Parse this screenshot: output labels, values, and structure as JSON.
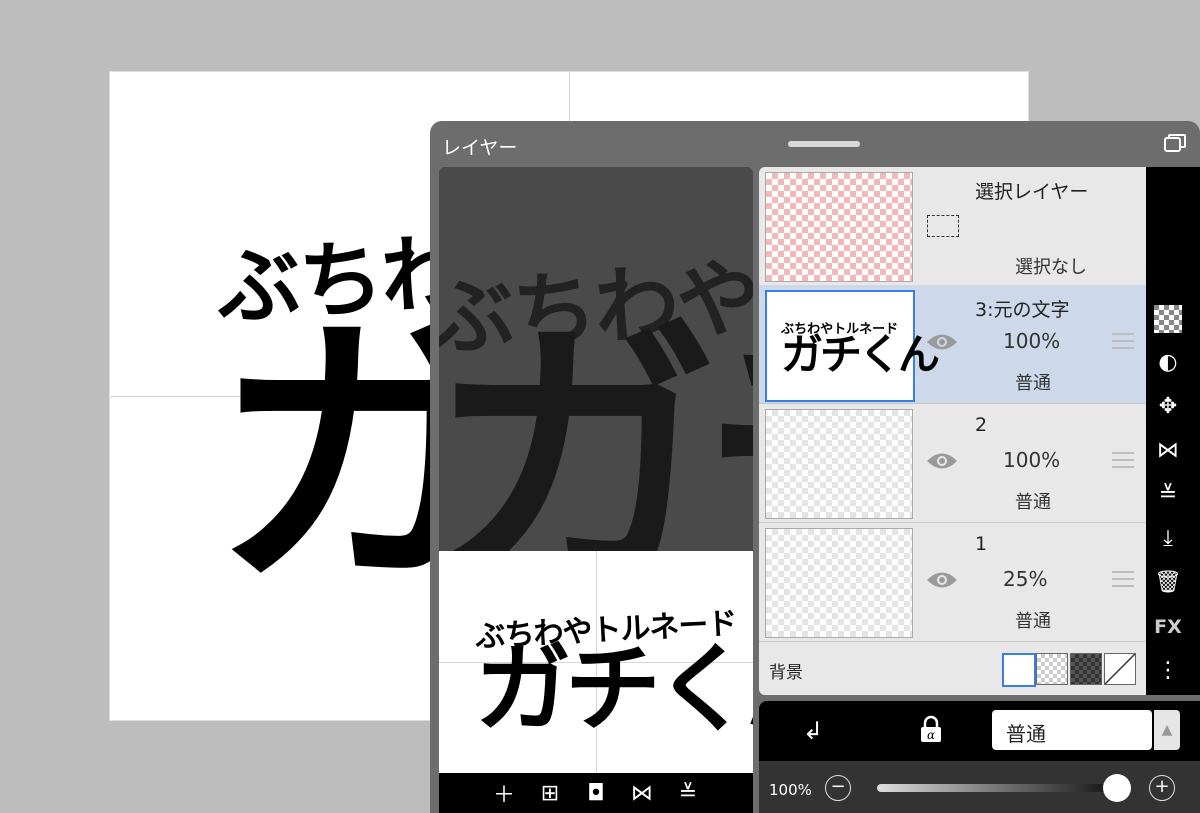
{
  "canvas": {
    "line1": "ぶちわやトルネード",
    "line2": "ガチくん"
  },
  "panel": {
    "title": "レイヤー",
    "layers": [
      {
        "name": "選択レイヤー",
        "status": "選択なし"
      },
      {
        "name": "3:元の文字",
        "opacity": "100%",
        "blend": "普通"
      },
      {
        "name": "2",
        "opacity": "100%",
        "blend": "普通"
      },
      {
        "name": "1",
        "opacity": "25%",
        "blend": "普通"
      }
    ],
    "background_label": "背景",
    "blend_mode": "普通",
    "opacity_readout": "100%",
    "opacity_value": 1.0
  },
  "tools": [
    "checker-icon",
    "invert-icon",
    "move-icon",
    "flip-h-icon",
    "flip-v-icon",
    "merge-down-icon",
    "trash-icon",
    "fx-label",
    "more-icon"
  ],
  "tools_fx": "FX",
  "colors": {
    "selected_row": "#cdd9ea",
    "accent": "#3b7ee2"
  }
}
